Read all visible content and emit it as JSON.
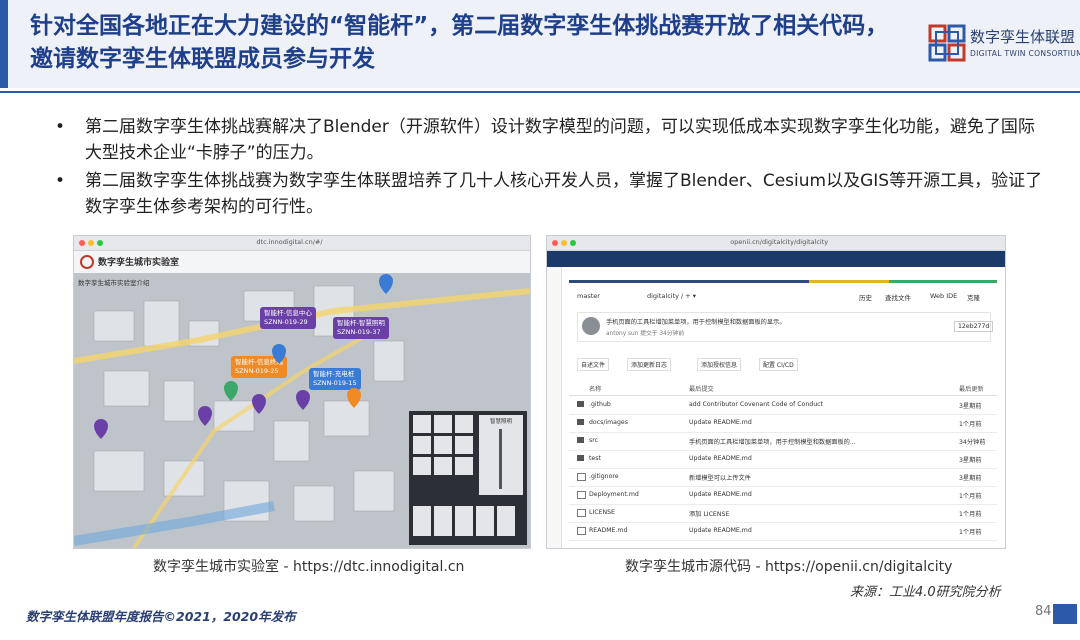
{
  "header": {
    "title": "针对全国各地正在大力建设的“智能杆”，第二届数字孪生体挑战赛开放了相关代码，邀请数字孪生体联盟成员参与开发",
    "logo_cn": "数字孪生体联盟",
    "logo_en": "DIGITAL TWIN CONSORTIUM"
  },
  "bullets": [
    "第二届数字孪生体挑战赛解决了Blender（开源软件）设计数字模型的问题，可以实现低成本实现数字孪生化功能，避免了国际大型技术企业“卡脖子”的压力。",
    "第二届数字孪生体挑战赛为数字孪生体联盟培养了几十人核心开发人员，掌握了Blender、Cesium以及GIS等开源工具，验证了数字孪生体参考架构的可行性。"
  ],
  "bullet_symbol": "•",
  "left_shot": {
    "url": "dtc.innodigital.cn/#/",
    "lab_title": "数字孪生城市实验室",
    "sub": "数字孪生城市实验室介绍",
    "pins": [
      {
        "name": "智能杆-信息中心",
        "code": "SZNN-019-29"
      },
      {
        "name": "智能杆-智慧照明",
        "code": "SZNN-019-37"
      },
      {
        "name": "智能杆-信息终端",
        "code": "SZNN-019-25"
      },
      {
        "name": "智能杆-充电桩",
        "code": "SZNN-019-15"
      }
    ],
    "panel_title": "智慧照明"
  },
  "right_shot": {
    "url": "openii.cn/digitalcity/digitalcity",
    "branch": "master",
    "path": "digitalcity / + ▾",
    "commit_msg": "手机页面的工具栏增加菜单项，用于控制模型和数据面板的显示。",
    "commit_author": "antony sun 提交于 34分钟前",
    "commit_hash": "12eb277d",
    "buttons": [
      "历史",
      "查找文件",
      "Web IDE",
      "克隆"
    ],
    "actions": [
      "自述文件",
      "添加更新日志",
      "添加授权信息",
      "配置 CI/CD"
    ],
    "columns": [
      "名称",
      "最后提交",
      "最后更新"
    ],
    "files": [
      {
        "name": ".github",
        "commit": "add Contributor Covenant Code of Conduct",
        "updated": "3星期前"
      },
      {
        "name": "docs/images",
        "commit": "Update README.md",
        "updated": "1个月前"
      },
      {
        "name": "src",
        "commit": "手机页面的工具栏增加菜单项，用于控制模型和数据面板的...",
        "updated": "34分钟前"
      },
      {
        "name": "test",
        "commit": "Update README.md",
        "updated": "3星期前"
      },
      {
        "name": ".gitignore",
        "commit": "新增模型可以上传文件",
        "updated": "3星期前"
      },
      {
        "name": "Deployment.md",
        "commit": "Update README.md",
        "updated": "1个月前"
      },
      {
        "name": "LICENSE",
        "commit": "添加 LICENSE",
        "updated": "1个月前"
      },
      {
        "name": "README.md",
        "commit": "Update README.md",
        "updated": "1个月前"
      }
    ]
  },
  "captions": {
    "left": "数字孪生城市实验室 - https://dtc.innodigital.cn",
    "right": "数字孪生城市源代码 - https://openii.cn/digitalcity"
  },
  "source": "来源：工业4.0研究院分析",
  "footer": "数字孪生体联盟年度报告©2021，2020年发布",
  "page_number": "84",
  "colors": {
    "brand": "#1f3f8a",
    "accent": "#2d5aa8",
    "pin_purple": "#6a3fa8",
    "pin_orange": "#f08a24",
    "pin_blue": "#3a7bd5"
  }
}
